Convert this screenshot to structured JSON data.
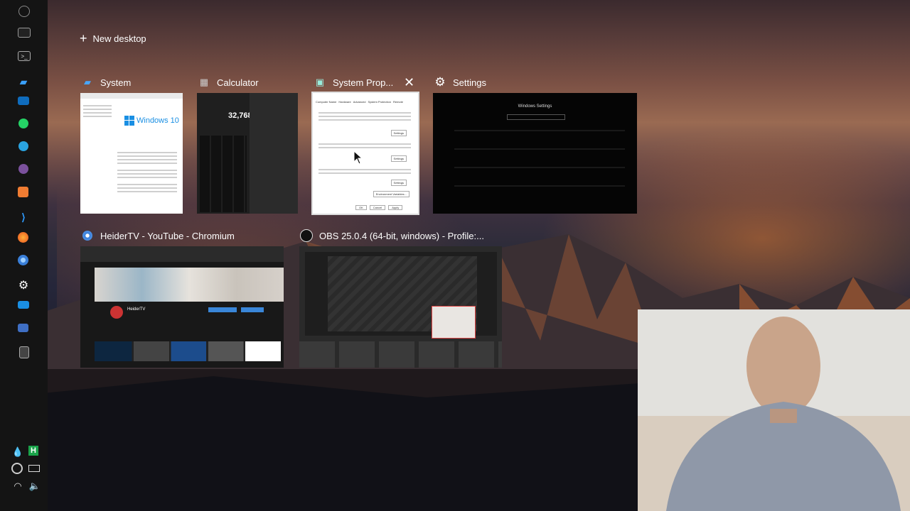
{
  "new_desktop": {
    "label": "New desktop"
  },
  "windows": [
    {
      "title": "System",
      "icon": "system-pc-icon"
    },
    {
      "title": "Calculator",
      "icon": "calculator-icon",
      "display": "32,768"
    },
    {
      "title": "System Prop...",
      "icon": "system-properties-icon",
      "tabs": [
        "Computer Name",
        "Hardware",
        "Advanced",
        "System Protection",
        "Remote"
      ],
      "buttons": [
        "Settings",
        "Settings",
        "Settings",
        "Environment Variables...",
        "OK",
        "Cancel",
        "Apply"
      ]
    },
    {
      "title": "Settings",
      "icon": "gear-icon",
      "heading": "Windows Settings"
    },
    {
      "title": "HeiderTV - YouTube - Chromium",
      "icon": "chromium-icon",
      "channel": "HeiderTV"
    },
    {
      "title": "OBS 25.0.4 (64-bit, windows) - Profile:...",
      "icon": "obs-icon"
    }
  ],
  "system_thumb": {
    "logo_text": "Windows 10"
  },
  "taskbar": {
    "pinned": [
      "chromium-grey-icon",
      "terminal-icon",
      "cmd-icon",
      "system-icon",
      "mail-icon",
      "whatsapp-icon",
      "telegram-icon",
      "viber-icon",
      "orange-app-icon",
      "vscode-icon",
      "firefox-icon",
      "chromium-icon",
      "settings-gear-icon",
      "mail-blue-icon",
      "remote-desktop-icon",
      "calculator-icon"
    ],
    "tray": [
      "droplet-icon",
      "h-app-icon",
      "chrome-tray-icon",
      "battery-icon",
      "wifi-icon",
      "volume-icon"
    ]
  },
  "colors": {
    "taskbar_bg": "#141414",
    "accent_blue": "#0078d7"
  }
}
